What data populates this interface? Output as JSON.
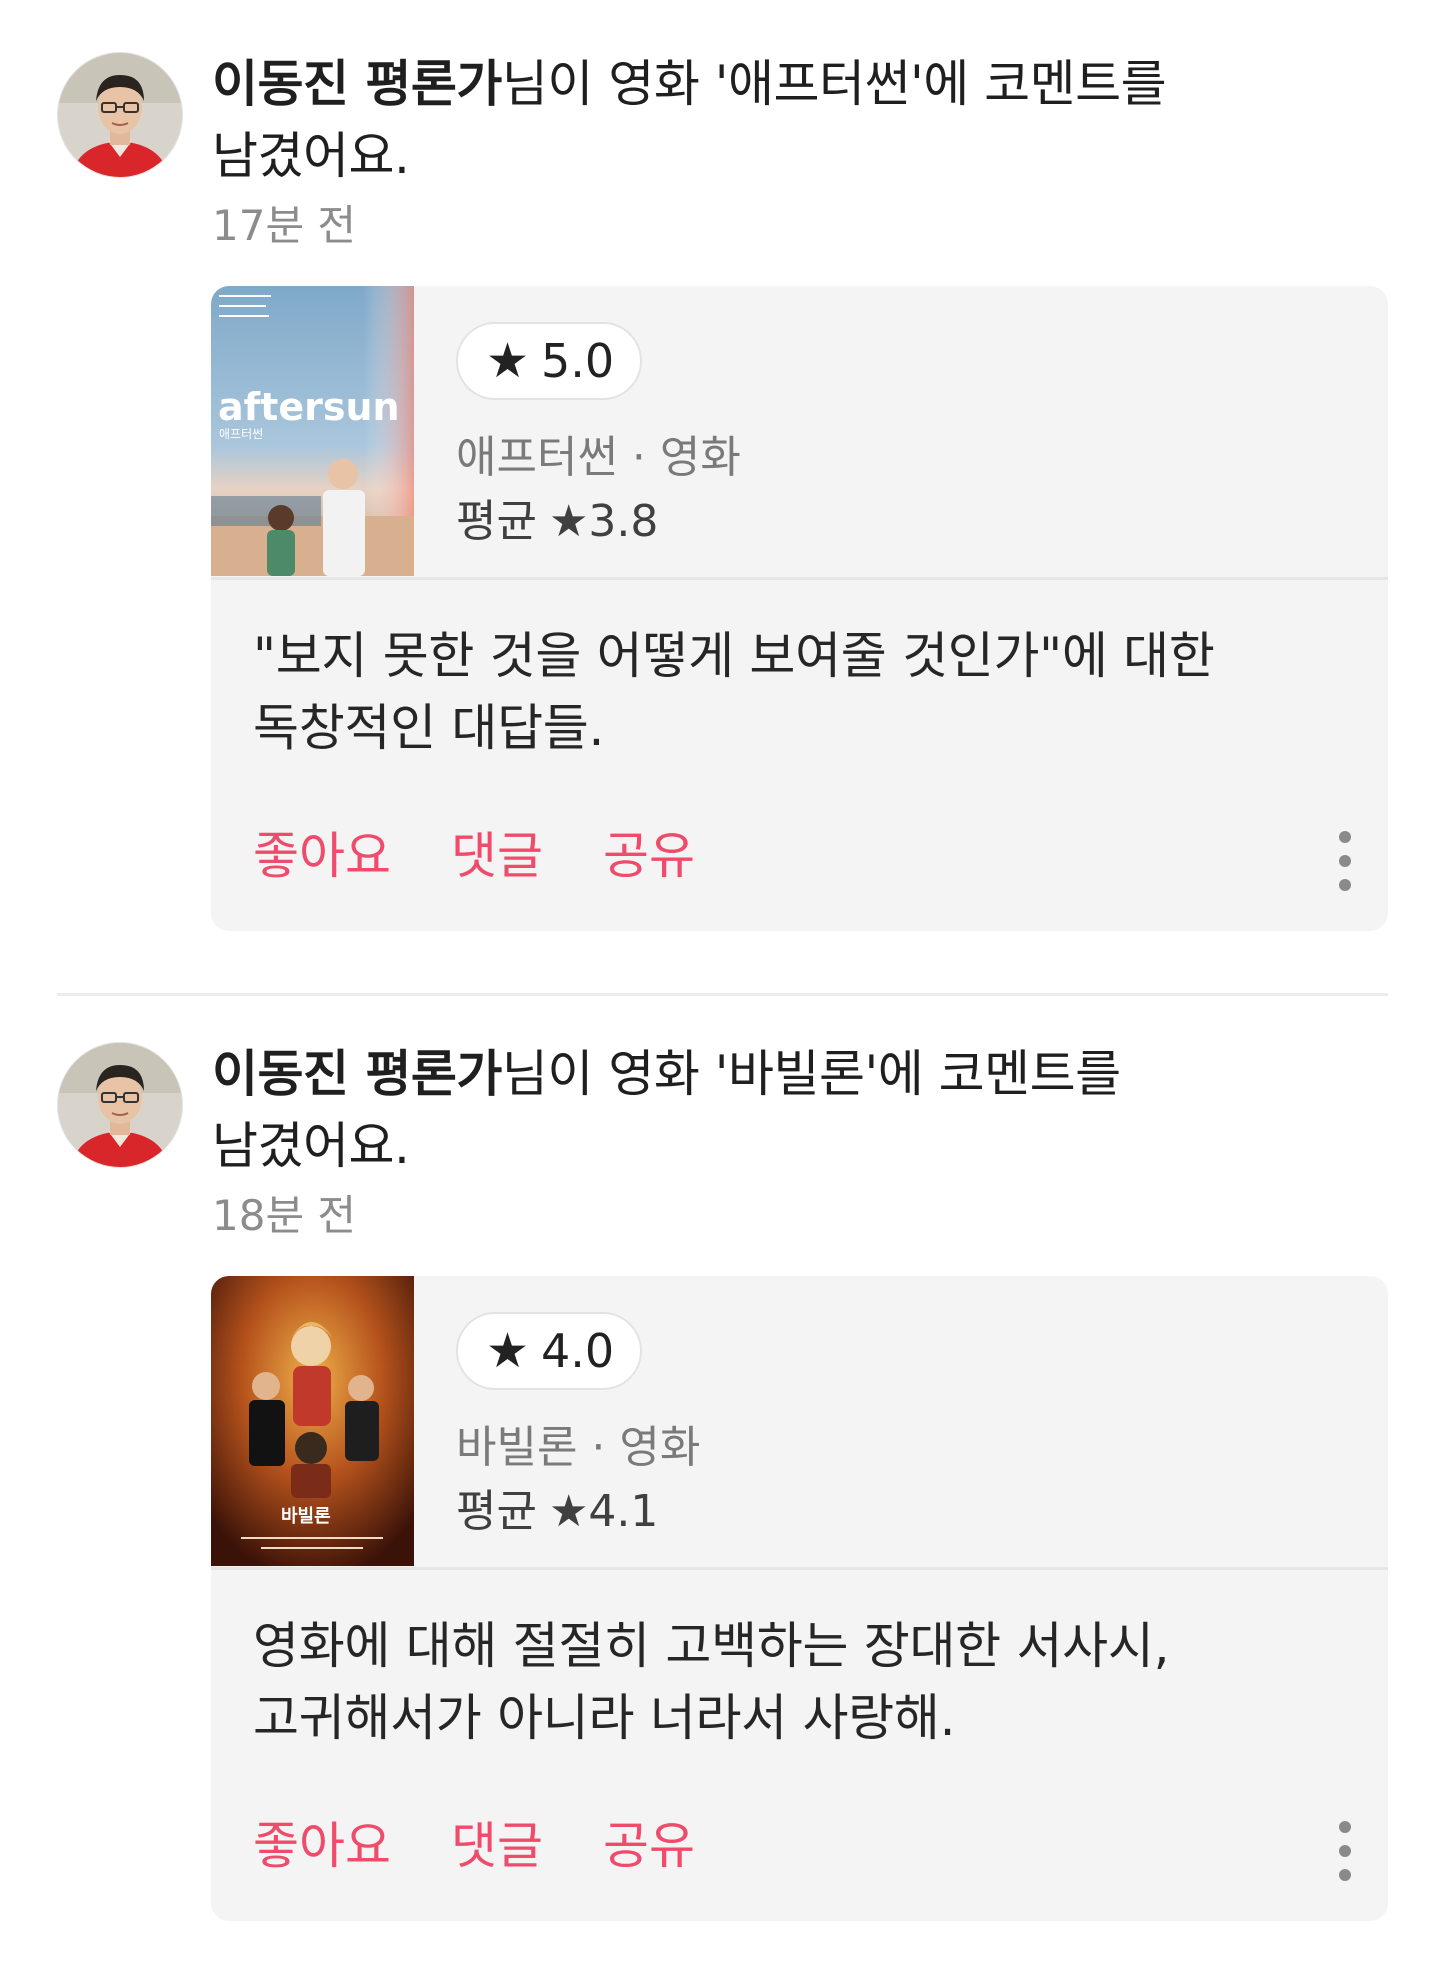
{
  "feed": {
    "items": [
      {
        "critic": "이동진 평론가",
        "action_text": "님이 영화 '애프터썬'에 코멘트를",
        "action_text_2": "남겼어요.",
        "time": "17분 전",
        "poster_icon": "aftersun-poster",
        "poster_title": "aftersun",
        "poster_subtitle": "애프터썬",
        "rating": "5.0",
        "movie_meta": "애프터썬 · 영화",
        "avg_label": "평균",
        "avg_value": "★3.8",
        "comment_line1": "\"보지 못한 것을 어떻게 보여줄 것인가\"에 대한",
        "comment_line2": "독창적인 대답들.",
        "like": "좋아요",
        "reply": "댓글",
        "share": "공유"
      },
      {
        "critic": "이동진 평론가",
        "action_text": "님이 영화 '바빌론'에 코멘트를",
        "action_text_2": "남겼어요.",
        "time": "18분 전",
        "poster_icon": "babylon-poster",
        "poster_title": "바빌론",
        "rating": "4.0",
        "movie_meta": "바빌론 · 영화",
        "avg_label": "평균",
        "avg_value": "★4.1",
        "comment_line1": "영화에 대해 절절히 고백하는 장대한 서사시,",
        "comment_line2": "고귀해서가 아니라 너라서 사랑해.",
        "like": "좋아요",
        "reply": "댓글",
        "share": "공유"
      }
    ]
  },
  "icons": {
    "star": "star-icon",
    "more": "more-vertical-icon",
    "avatar": "critic-avatar"
  },
  "colors": {
    "accent": "#ef4b6b",
    "card_bg": "#f4f4f4",
    "muted_text": "#8c8c8c"
  }
}
